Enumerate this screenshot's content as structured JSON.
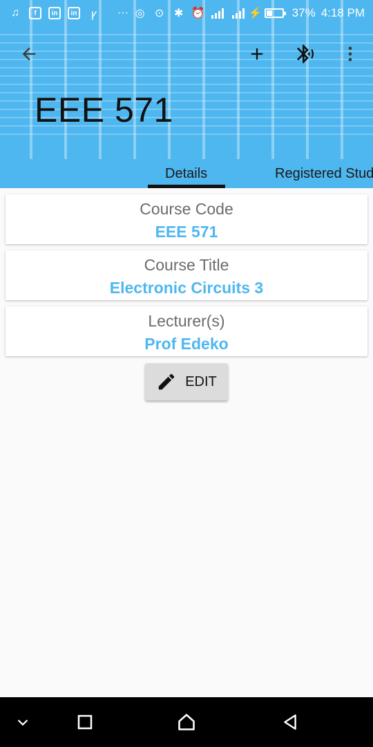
{
  "status_bar": {
    "battery": "37%",
    "time": "4:18 PM",
    "battery_level": 0.37,
    "icons_left": [
      "music-note-icon",
      "facebook-icon",
      "linkedin-icon",
      "linkedin-icon",
      "app-icon",
      "more-dots-icon"
    ],
    "icons_right": [
      "hotspot-icon",
      "location-icon",
      "bluetooth-icon",
      "alarm-icon",
      "signal-icon",
      "signal-icon",
      "charging-icon",
      "battery-icon"
    ]
  },
  "toolbar": {
    "back_icon": "arrow-left-icon",
    "add_icon": "plus-icon",
    "bluetooth_icon": "bluetooth-connect-icon",
    "menu_icon": "more-vertical-icon"
  },
  "header": {
    "title": "EEE 571",
    "accent_color": "#4fb7ef"
  },
  "tabs": [
    {
      "label": "Details",
      "selected": true
    },
    {
      "label": "Registered Stud",
      "selected": false
    }
  ],
  "details": [
    {
      "label": "Course Code",
      "value": "EEE 571"
    },
    {
      "label": "Course Title",
      "value": "Electronic Circuits 3"
    },
    {
      "label": "Lecturer(s)",
      "value": "Prof Edeko"
    }
  ],
  "edit_button": {
    "label": "EDIT",
    "icon": "pencil-icon"
  },
  "nav_bar": [
    "chevron-down-icon",
    "recents-square-icon",
    "home-icon",
    "back-triangle-icon"
  ]
}
